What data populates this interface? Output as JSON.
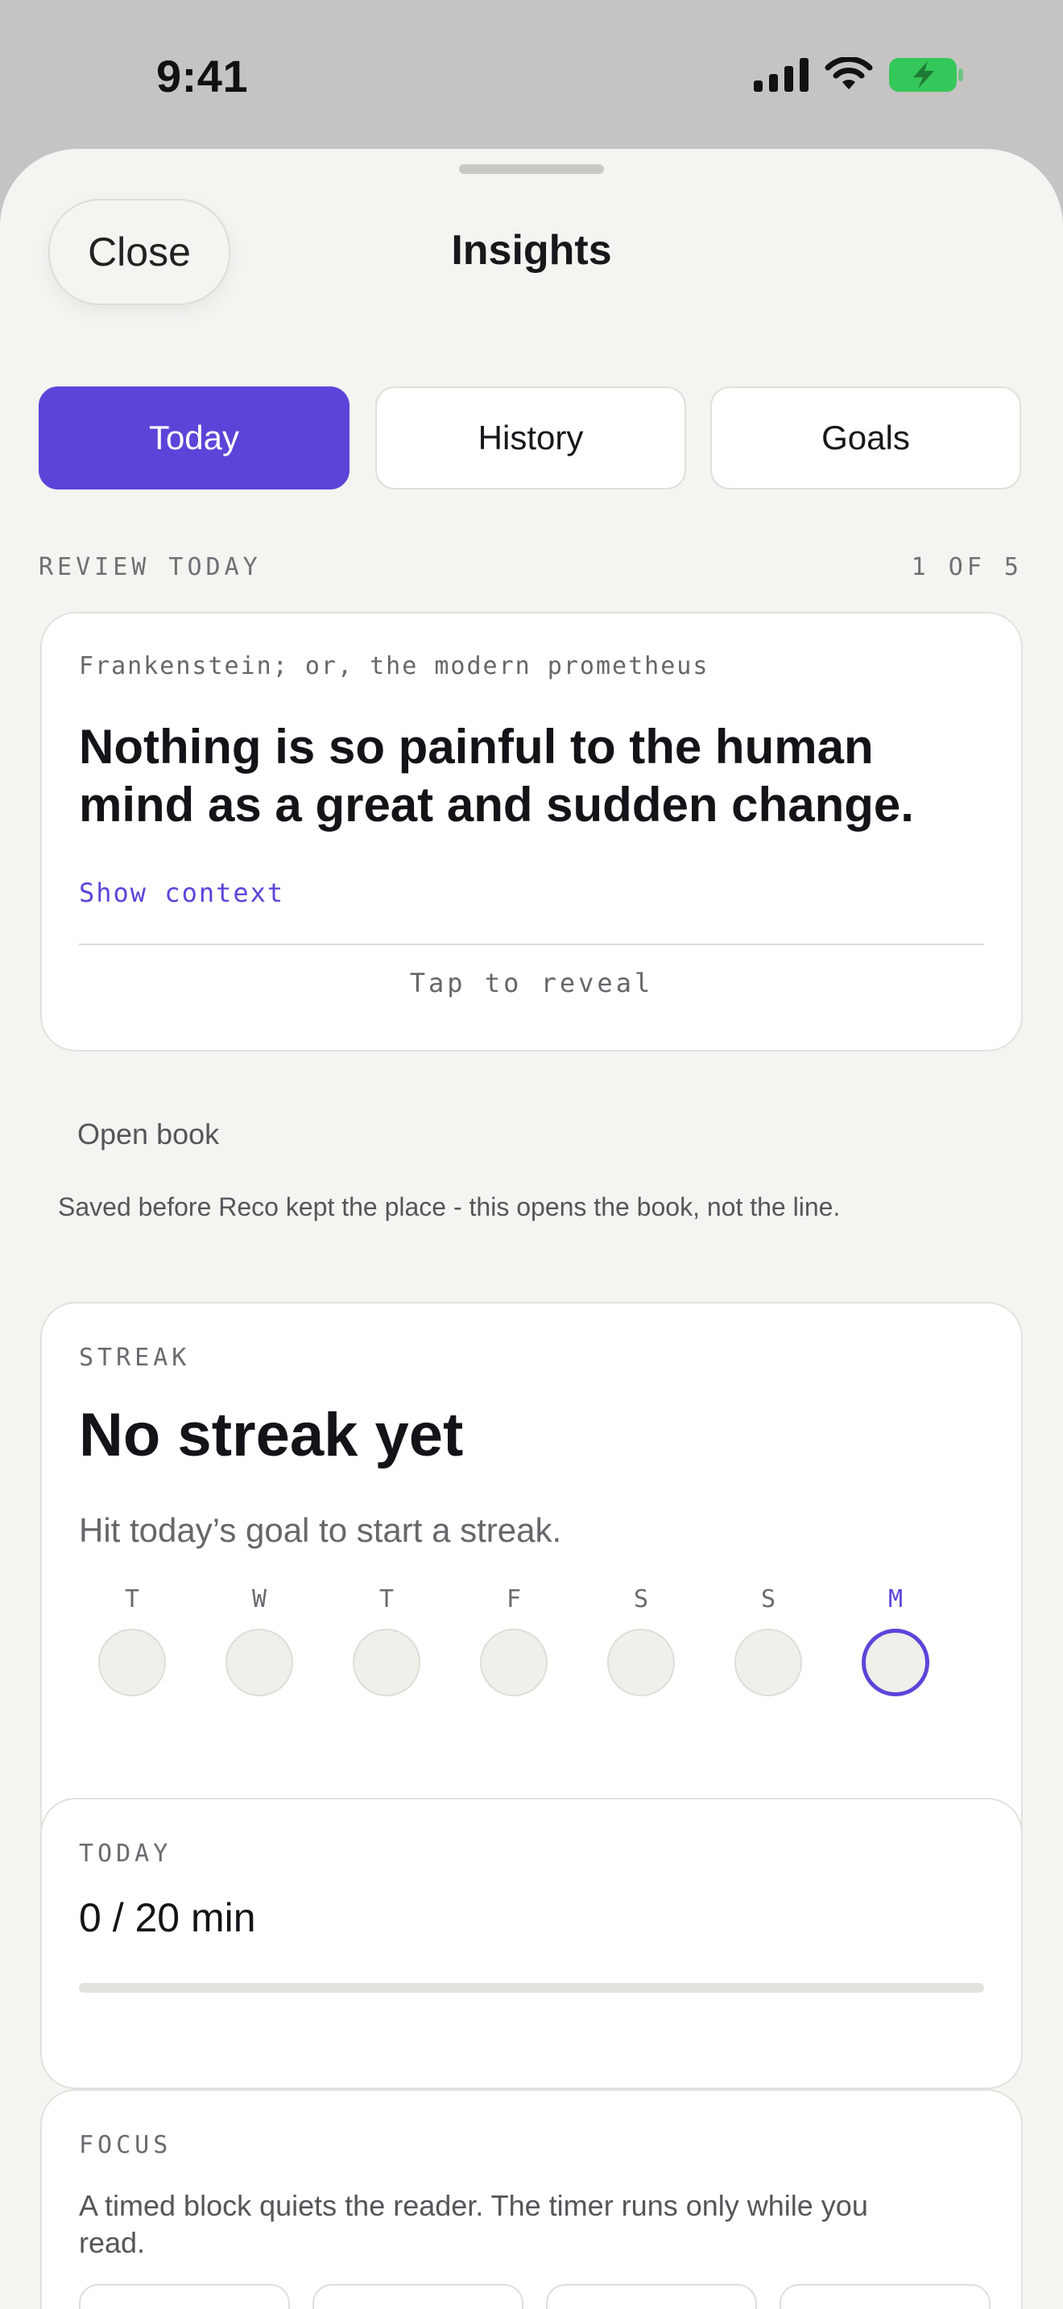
{
  "status_bar": {
    "time": "9:41"
  },
  "sheet": {
    "title": "Insights",
    "close_label": "Close"
  },
  "tabs": [
    {
      "label": "Today",
      "active": true
    },
    {
      "label": "History",
      "active": false
    },
    {
      "label": "Goals",
      "active": false
    }
  ],
  "review": {
    "section_label": "REVIEW TODAY",
    "counter": "1 OF 5",
    "source": "Frankenstein; or, the modern prometheus",
    "quote": "Nothing is so painful to the human mind as a great and sudden change.",
    "show_context": "Show context",
    "reveal": "Tap to reveal"
  },
  "open_book": {
    "label": "Open book",
    "note": "Saved before Reco kept the place - this opens the book, not the line."
  },
  "streak": {
    "label": "STREAK",
    "title": "No streak yet",
    "subtitle": "Hit today’s goal to start a streak.",
    "days": [
      {
        "letter": "T",
        "current": false
      },
      {
        "letter": "W",
        "current": false
      },
      {
        "letter": "T",
        "current": false
      },
      {
        "letter": "F",
        "current": false
      },
      {
        "letter": "S",
        "current": false
      },
      {
        "letter": "S",
        "current": false
      },
      {
        "letter": "M",
        "current": true
      }
    ]
  },
  "today": {
    "label": "TODAY",
    "value": "0 / 20 min",
    "progress_fraction": 0
  },
  "focus": {
    "label": "FOCUS",
    "description": "A timed block quiets the reader. The timer runs only while you read."
  },
  "colors": {
    "accent": "#5b45d9",
    "sheet_background": "#f5f4f1",
    "backdrop": "#c5c4c3",
    "battery": "#34c759"
  }
}
